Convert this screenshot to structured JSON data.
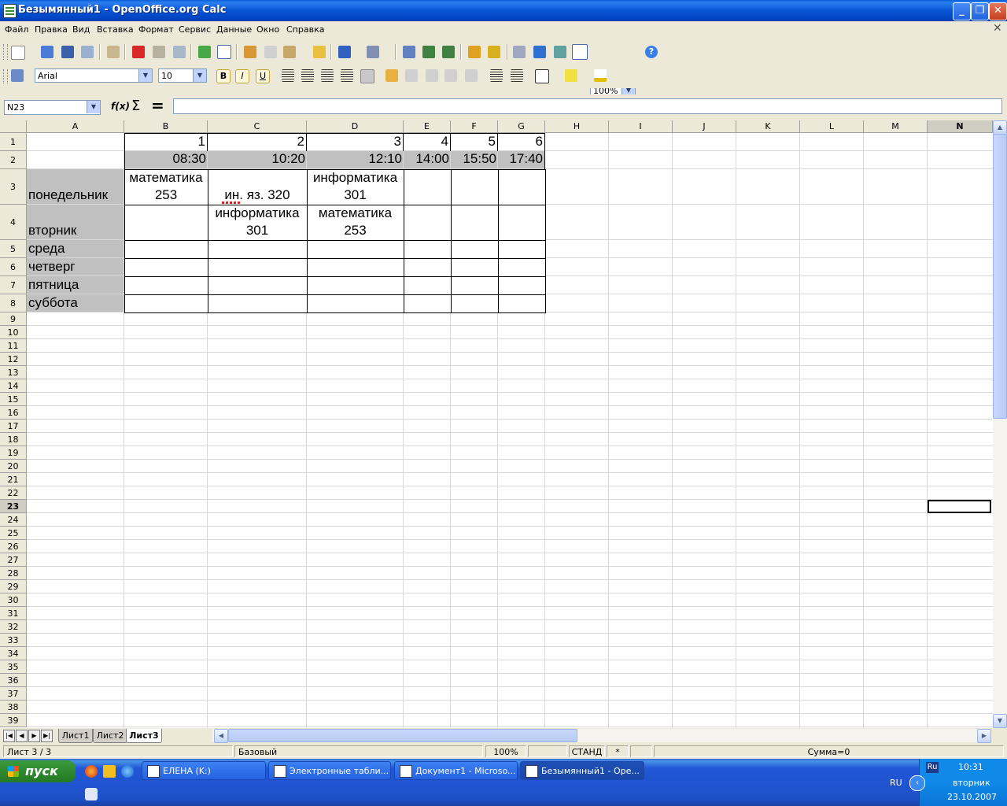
{
  "window": {
    "title": "Безымянный1 - OpenOffice.org Calc"
  },
  "menu": [
    "Файл",
    "Правка",
    "Вид",
    "Вставка",
    "Формат",
    "Сервис",
    "Данные",
    "Окно",
    "Справка"
  ],
  "toolbar": {
    "zoom": "100%",
    "font_name": "Arial",
    "font_size": "10",
    "bold": "B",
    "italic": "I",
    "underline": "U"
  },
  "formula": {
    "name_box": "N23",
    "value": ""
  },
  "columns": [
    "A",
    "B",
    "C",
    "D",
    "E",
    "F",
    "G",
    "H",
    "I",
    "J",
    "K",
    "L",
    "M",
    "N"
  ],
  "rows": [
    "1",
    "2",
    "3",
    "4",
    "5",
    "6",
    "7",
    "8",
    "9",
    "10",
    "11",
    "12",
    "13",
    "14",
    "15",
    "16",
    "17",
    "18",
    "19",
    "20",
    "21",
    "22",
    "23",
    "24",
    "25",
    "26",
    "27",
    "28",
    "29",
    "30",
    "31",
    "32",
    "33",
    "34",
    "35",
    "36",
    "37",
    "38",
    "39"
  ],
  "cells": {
    "B1": "1",
    "C1": "2",
    "D1": "3",
    "E1": "4",
    "F1": "5",
    "G1": "6",
    "B2": "08:30",
    "C2": "10:20",
    "D2": "12:10",
    "E2": "14:00",
    "F2": "15:50",
    "G2": "17:40",
    "A3": "понедельник",
    "B3_l1": "математика",
    "B3_l2": "253",
    "C3": "ин. яз. 320",
    "D3_l1": "информатика",
    "D3_l2": "301",
    "A4": "вторник",
    "C4_l1": "информатика",
    "C4_l2": "301",
    "D4_l1": "математика",
    "D4_l2": "253",
    "A5": "среда",
    "A6": "четверг",
    "A7": "пятница",
    "A8": "суббота"
  },
  "sheets": [
    "Лист1",
    "Лист2",
    "Лист3"
  ],
  "status": {
    "sheet": "Лист 3 / 3",
    "style": "Базовый",
    "zoom": "100%",
    "mode": "СТАНД",
    "modified": "*",
    "sum": "Сумма=0"
  },
  "taskbar": {
    "start": "пуск",
    "buttons": [
      "ЕЛЕНА (K:)",
      "Электронные табли...",
      "Документ1 - Microso...",
      "Безымянный1 - Ope..."
    ],
    "lang": "Ru",
    "lang2": "RU",
    "time": "10:31",
    "day": "вторник",
    "date": "23.10.2007"
  },
  "colors": {
    "title_bar": "#0954d6",
    "header_gray": "#c0c0c0",
    "selection": "#000000"
  }
}
